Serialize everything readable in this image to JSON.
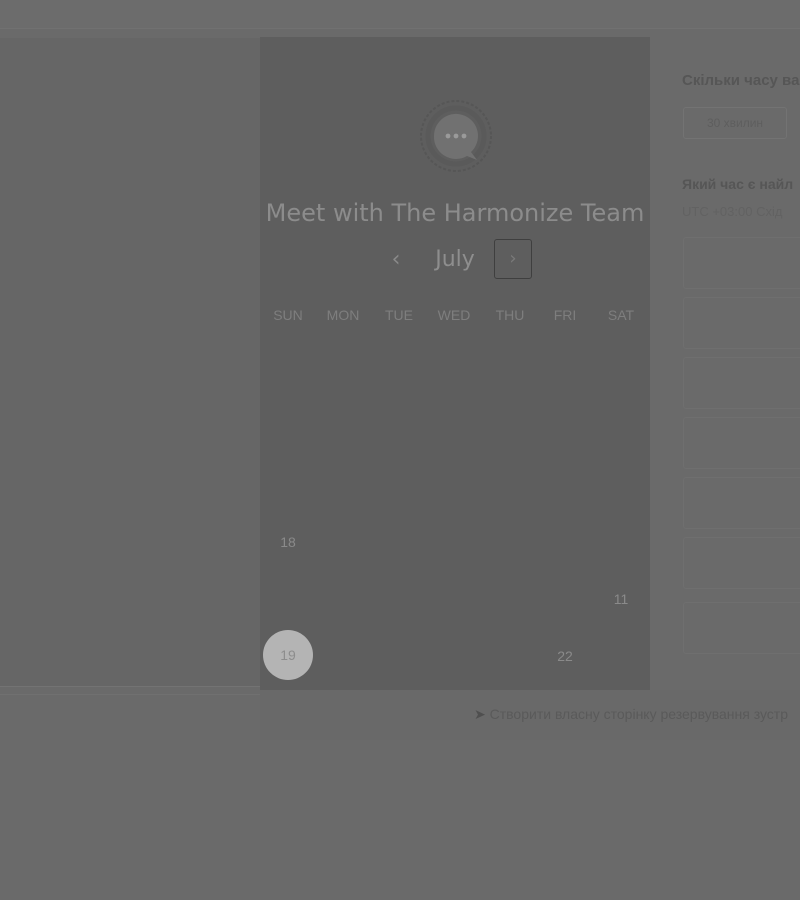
{
  "event": {
    "title": "Meet with The Harmonize Team"
  },
  "calendar": {
    "month": "July",
    "prev_icon": "‹",
    "next_icon": "›",
    "weekdays": [
      "SUN",
      "MON",
      "TUE",
      "WED",
      "THU",
      "FRI",
      "SAT"
    ],
    "visible_days": {
      "row4_sun": "18",
      "row5_sat": "11",
      "row6_sun": "19",
      "row6_fri": "22"
    },
    "selected_day": "19"
  },
  "booking": {
    "duration_question": "Скільки часу ва",
    "duration_option": "30 хвилин",
    "time_question": "Який час є найл",
    "timezone": "UTC +03:00 Схід"
  },
  "footer": {
    "arrow_icon": "➤",
    "link_text": "Створити власну сторінку резервування зустр"
  },
  "colors": {
    "overlay": "#6a6a6a",
    "card": "#5e5e5e",
    "selected_day": "#b4b4b4"
  }
}
